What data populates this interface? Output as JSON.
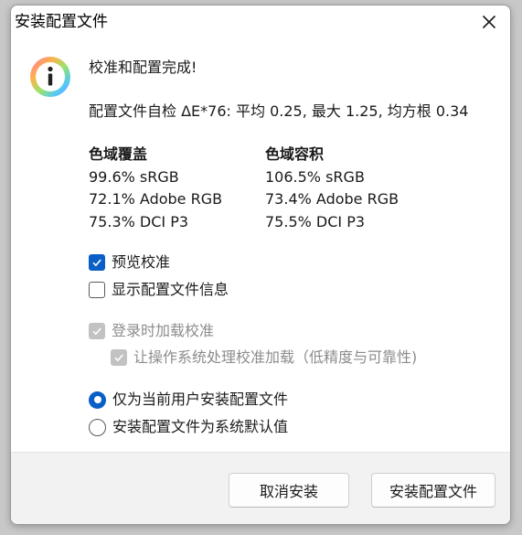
{
  "window": {
    "title": "安装配置文件",
    "close_icon": "close-icon"
  },
  "message": {
    "icon": "info-icon",
    "heading": "校准和配置完成!",
    "self_check": "配置文件自检 ΔE*76: 平均 0.25, 最大 1.25, 均方根 0.34"
  },
  "gamut": {
    "coverage": {
      "heading": "色域覆盖",
      "rows": [
        "99.6% sRGB",
        "72.1% Adobe RGB",
        "75.3% DCI P3"
      ]
    },
    "volume": {
      "heading": "色域容积",
      "rows": [
        "106.5% sRGB",
        "73.4% Adobe RGB",
        "75.5% DCI P3"
      ]
    }
  },
  "options": {
    "preview_calibration": {
      "label": "预览校准",
      "checked": true
    },
    "show_profile_info": {
      "label": "显示配置文件信息",
      "checked": false
    },
    "load_on_login": {
      "label": "登录时加载校准",
      "checked": true,
      "disabled": true
    },
    "os_handles_loading": {
      "label": "让操作系统处理校准加载（低精度与可靠性)",
      "checked": true,
      "disabled": true
    }
  },
  "install_scope": {
    "current_user": {
      "label": "仅为当前用户安装配置文件",
      "selected": true
    },
    "system_default": {
      "label": "安装配置文件为系统默认值",
      "selected": false
    }
  },
  "buttons": {
    "cancel": "取消安装",
    "install": "安装配置文件"
  },
  "colors": {
    "accent": "#0a5fc6",
    "disabled": "#c2c2c2",
    "footer_bg": "#f2f2f2"
  }
}
